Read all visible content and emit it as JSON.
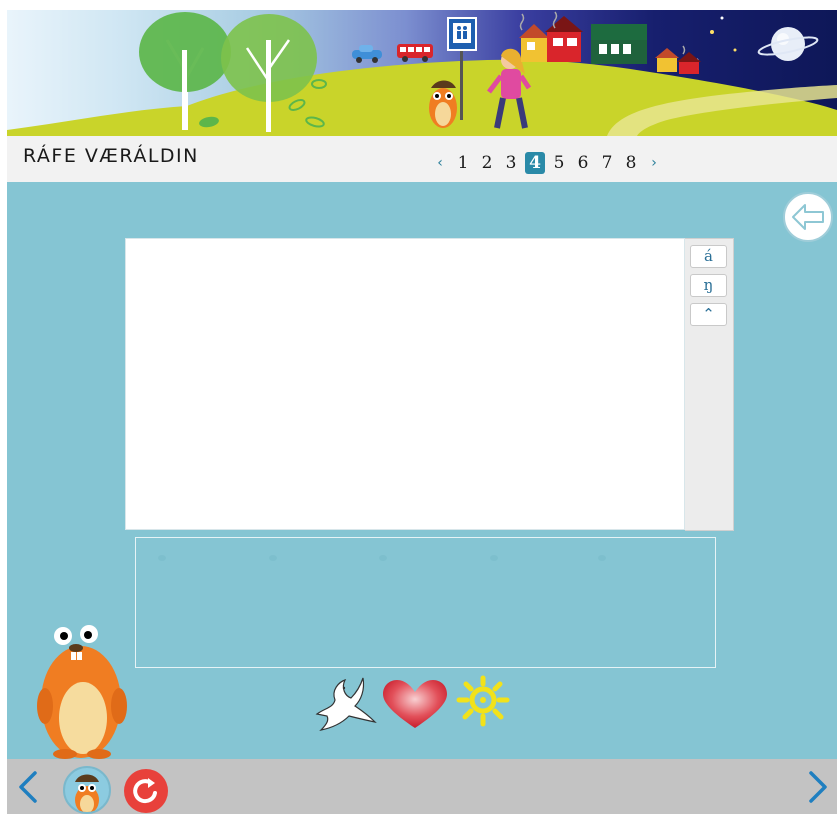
{
  "header": {
    "app_title": "RÁFE VÆRÁLDIN"
  },
  "pager": {
    "prev_label": "‹",
    "next_label": "›",
    "pages": [
      "1",
      "2",
      "3",
      "4",
      "5",
      "6",
      "7",
      "8"
    ],
    "current_page": "4"
  },
  "char_panel": {
    "buttons": [
      "á",
      "ŋ",
      "⌃"
    ]
  },
  "picture_row": {
    "items": [
      "bird-icon",
      "heart-icon",
      "sun-icon"
    ]
  },
  "footer": {
    "prev_icon": "chevron-left-icon",
    "next_icon": "chevron-right-icon",
    "reset_icon": "reset-icon",
    "avatar_icon": "mascot-avatar-icon"
  },
  "colors": {
    "main_background": "#85c5d3",
    "title_bar": "#f2f2f2",
    "footer_bar": "#c3c3c3",
    "accent": "#2a8aa8",
    "reset_button": "#e8413b",
    "mascot_orange": "#f07d22"
  }
}
